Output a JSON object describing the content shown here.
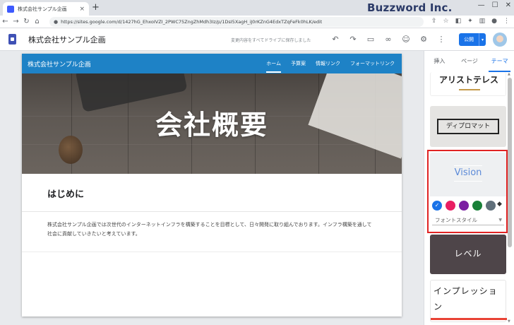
{
  "browser": {
    "tab_title": "株式会社サンプル企画",
    "tab_close": "×",
    "new_tab": "+",
    "watermark": "Buzzword Inc.",
    "url": "https://sites.google.com/d/1427hG_EhxoIVZI_2PWC75ZngZhMdh3Iz/p/1DsI5XagH_iJ0rKZnG4EdxTZqFeFk0hLK/edit",
    "nav_back": "←",
    "nav_forward": "→",
    "nav_reload": "↻",
    "nav_home": "⌂",
    "lock": "🔒",
    "window_min": "—",
    "window_max": "☐",
    "window_close": "✕"
  },
  "editor": {
    "site_name": "株式会社サンプル企画",
    "save_status": "変更内容をすべてドライブに保存しました",
    "publish_label": "公開",
    "publish_caret": "▾"
  },
  "site": {
    "title": "株式会社サンプル企画",
    "nav": [
      "ホーム",
      "予算案",
      "情報リンク",
      "フォーマットリンク"
    ],
    "hero_title": "会社概要",
    "section_title": "はじめに",
    "body": "株式会社サンプル企画では次世代のインターネットインフラを構築することを目標として、日々開発に取り組んでおります。インフラ構築を通して社会に貢献していきたいと考えています。"
  },
  "panel": {
    "tabs": [
      "挿入",
      "ページ",
      "テーマ"
    ],
    "active_tab": "テーマ",
    "themes": {
      "aristotle": "アリストテレス",
      "diplomat": "ディプロマット",
      "vision": "Vision",
      "level": "レベル",
      "impression": "インプレッション"
    },
    "font_style_label": "フォントスタイル",
    "swatch_colors": [
      "#1a73e8",
      "#e91e63",
      "#7b1fa2",
      "#188038",
      "#5f6f7a"
    ]
  },
  "colors": {
    "site_header": "#1e82c6",
    "publish": "#1a73e8",
    "selection": "#e02424"
  }
}
